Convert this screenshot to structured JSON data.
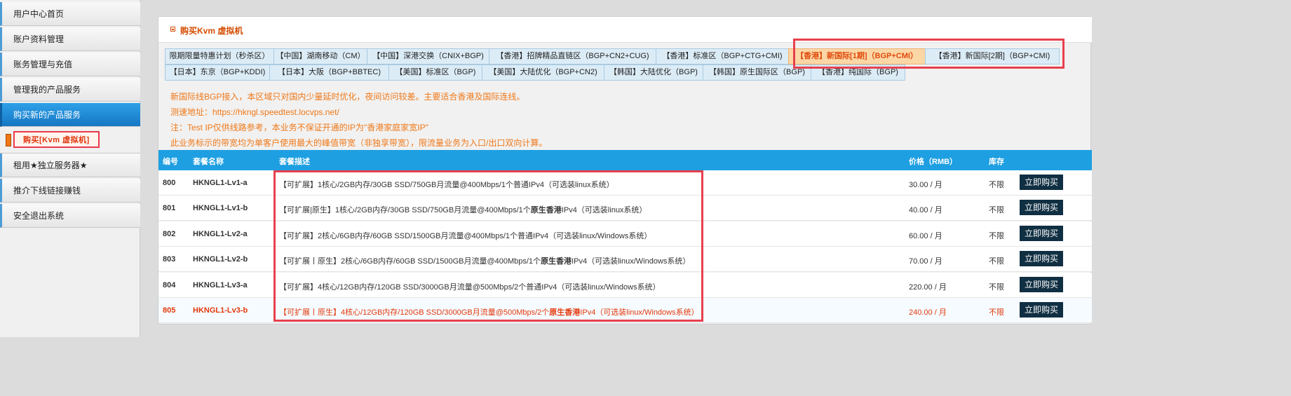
{
  "sidebar": {
    "items": [
      {
        "label": "用户中心首页"
      },
      {
        "label": "账户资料管理"
      },
      {
        "label": "账务管理与充值"
      },
      {
        "label": "管理我的产品服务"
      },
      {
        "label": "购买新的产品服务"
      },
      {
        "label": "租用★独立服务器★"
      },
      {
        "label": "推介下线链接赚钱"
      },
      {
        "label": "安全退出系统"
      }
    ],
    "sub_item": "购买[Kvm 虚拟机]"
  },
  "panel": {
    "title": "购买Kvm 虚拟机"
  },
  "tabs": [
    {
      "label": "限期限量特惠计划（秒杀区）"
    },
    {
      "label": "【中国】湖南移动（CM）"
    },
    {
      "label": "【中国】深港交换（CNIX+BGP)"
    },
    {
      "label": "【香港】招牌精品直链区（BGP+CN2+CUG)"
    },
    {
      "label": "【香港】标准区（BGP+CTG+CMI)"
    },
    {
      "label": "【香港】新国际[1期]（BGP+CMI）"
    },
    {
      "label": "【香港】新国际[2期]（BGP+CMI)"
    },
    {
      "label": "【日本】东京（BGP+KDDI)"
    },
    {
      "label": "【日本】大阪（BGP+BBTEC)"
    },
    {
      "label": "【美国】标准区（BGP)"
    },
    {
      "label": "【美国】大陆优化（BGP+CN2)"
    },
    {
      "label": "【韩国】大陆优化（BGP)"
    },
    {
      "label": "【韩国】原生国际区（BGP)"
    },
    {
      "label": "【香港】纯国际（BGP)"
    }
  ],
  "notices": [
    "新国际线BGP接入，本区域只对国内少量延时优化，夜间访问较差。主要适合香港及国际连线。",
    "测速地址：https://hkngl.speedtest.locvps.net/",
    "注：Test IP仅供线路参考，本业务不保证开通的IP为\"香港家庭家宽IP\"",
    "此业务标示的带宽均为单客户使用最大的峰值带宽（非独享带宽），限流量业务为入口/出口双向计算。"
  ],
  "table": {
    "headers": {
      "id": "编号",
      "name": "套餐名称",
      "desc": "套餐描述",
      "price": "价格（RMB）",
      "stock": "库存"
    },
    "buy_label": "立即购买",
    "rows": [
      {
        "id": "800",
        "name": "HKNGL1-Lv1-a",
        "desc_pre": "【可扩展】1核心/2GB内存/30GB SSD/750GB月流量@400Mbps/1个普通IPv4（可选装linux系统）",
        "desc_bold": "",
        "desc_post": "",
        "price": "30.00 / 月",
        "stock": "不限"
      },
      {
        "id": "801",
        "name": "HKNGL1-Lv1-b",
        "desc_pre": "【可扩展|原生】1核心/2GB内存/30GB SSD/750GB月流量@400Mbps/1个",
        "desc_bold": "原生香港",
        "desc_post": "IPv4（可选装linux系统）",
        "price": "40.00 / 月",
        "stock": "不限"
      },
      {
        "id": "802",
        "name": "HKNGL1-Lv2-a",
        "desc_pre": "【可扩展】2核心/6GB内存/60GB SSD/1500GB月流量@400Mbps/1个普通IPv4（可选装linux/Windows系统）",
        "desc_bold": "",
        "desc_post": "",
        "price": "60.00 / 月",
        "stock": "不限"
      },
      {
        "id": "803",
        "name": "HKNGL1-Lv2-b",
        "desc_pre": "【可扩展丨原生】2核心/6GB内存/60GB SSD/1500GB月流量@400Mbps/1个",
        "desc_bold": "原生香港",
        "desc_post": "IPv4（可选装linux/Windows系统）",
        "price": "70.00 / 月",
        "stock": "不限"
      },
      {
        "id": "804",
        "name": "HKNGL1-Lv3-a",
        "desc_pre": "【可扩展】4核心/12GB内存/120GB SSD/3000GB月流量@500Mbps/2个普通IPv4（可选装linux/Windows系统）",
        "desc_bold": "",
        "desc_post": "",
        "price": "220.00 / 月",
        "stock": "不限"
      },
      {
        "id": "805",
        "name": "HKNGL1-Lv3-b",
        "desc_pre": "【可扩展丨原生】4核心/12GB内存/120GB SSD/3000GB月流量@500Mbps/2个",
        "desc_bold": "原生香港",
        "desc_post": "IPv4（可选装linux/Windows系统）",
        "price": "240.00 / 月",
        "stock": "不限"
      }
    ]
  },
  "colors": {
    "accent_blue": "#1e9fe1",
    "highlight_orange": "#f07818",
    "annotation_red": "#e8404e",
    "buy_button": "#102f42"
  }
}
